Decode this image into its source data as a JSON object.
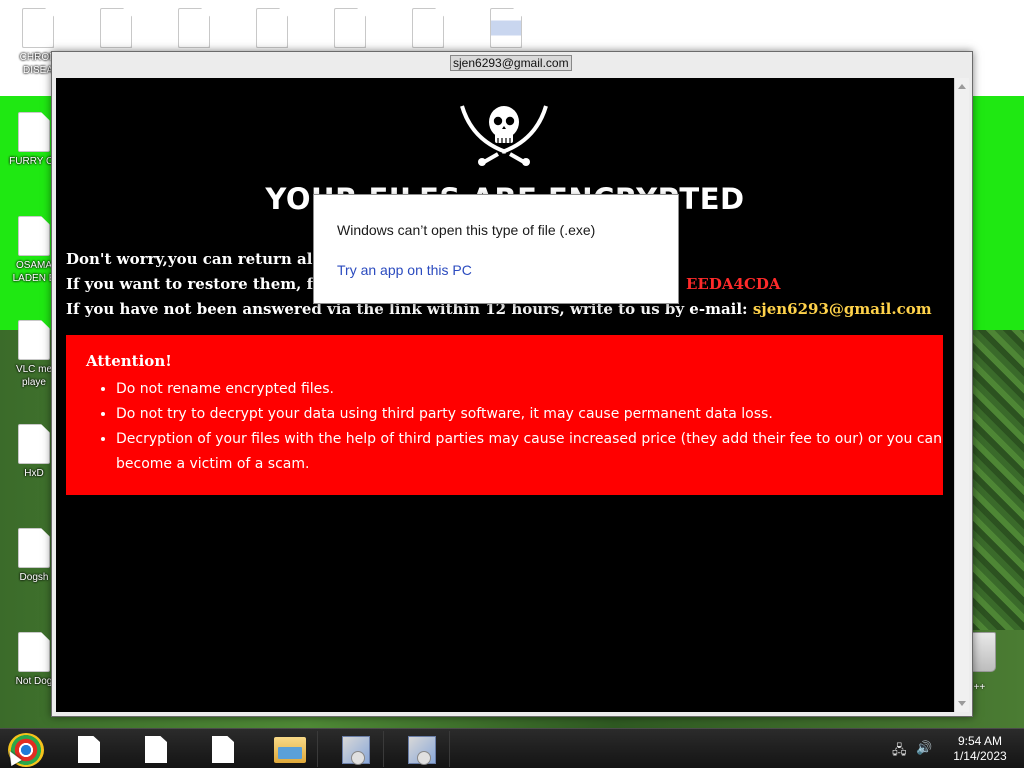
{
  "window": {
    "title": "sjen6293@gmail.com"
  },
  "ransom": {
    "headline": "YOUR FILES ARE ENCRYPTED",
    "line1": "Don't worry,you can return all yo",
    "line2": "If you want to restore them, follo",
    "line2_id": "EEDA4CDA",
    "line3_prefix": "If you have not been answered via the link within 12 hours, write to us by e-mail: ",
    "line3_email": "sjen6293@gmail.com",
    "attention": {
      "title": "Attention!",
      "items": [
        "Do not rename encrypted files.",
        "Do not try to decrypt your data using third party software, it may cause permanent data loss.",
        "Decryption of your files with the help of third parties may cause increased price (they add their fee to our) or you can become a victim of a scam."
      ]
    }
  },
  "dialog": {
    "message": "Windows can’t open this type of file (.exe)",
    "link": "Try an app on this PC"
  },
  "desktop": {
    "icons": [
      {
        "label": "CHRON\nDISEA"
      },
      {
        "label": "FURRY CL"
      },
      {
        "label": "OSAMA\nLADEN B"
      },
      {
        "label": "VLC me\nplaye"
      },
      {
        "label": "HxD"
      },
      {
        "label": "Dogsh"
      },
      {
        "label": "Not Dog"
      }
    ],
    "right_label": "n C++"
  },
  "taskbar": {
    "time": "9:54 AM",
    "date": "1/14/2023"
  },
  "colors": {
    "body_bg": "#000000",
    "attention_bg": "#ff0000",
    "id_color": "#ff2a2a",
    "email_color": "#ffd24a",
    "link_color": "#2b4bbf",
    "wallpaper_green": "#1fe812"
  }
}
